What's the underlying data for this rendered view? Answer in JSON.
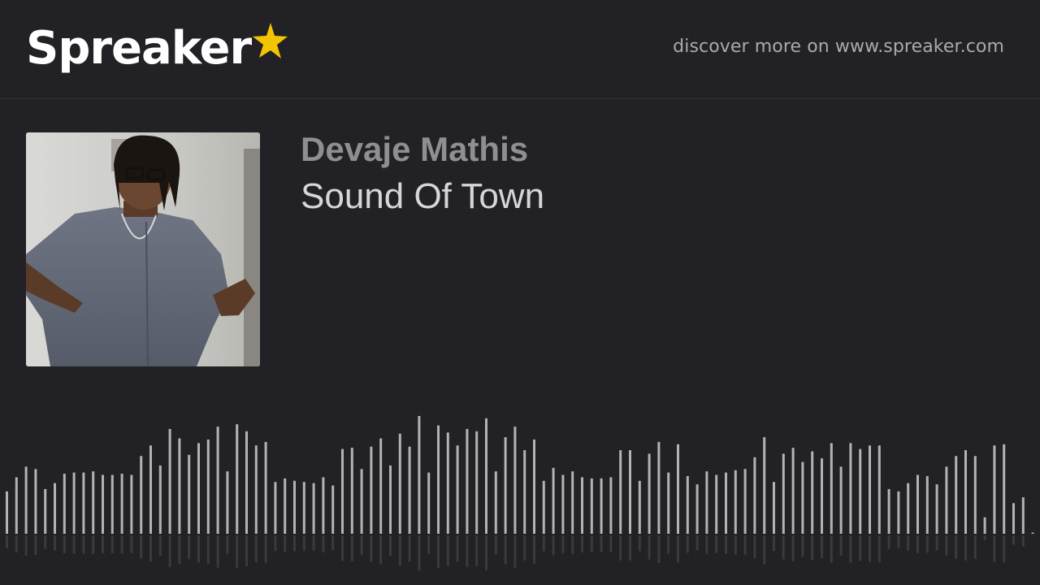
{
  "header": {
    "logo_text": "Spreaker",
    "discover_text": "discover more on www.spreaker.com"
  },
  "episode": {
    "author": "Devaje Mathis",
    "title": "Sound Of Town"
  },
  "waveform": {
    "levels": [
      0.36,
      0.48,
      0.57,
      0.55,
      0.38,
      0.43,
      0.51,
      0.52,
      0.52,
      0.53,
      0.5,
      0.5,
      0.51,
      0.5,
      0.66,
      0.75,
      0.58,
      0.89,
      0.81,
      0.67,
      0.77,
      0.8,
      0.91,
      0.53,
      0.93,
      0.87,
      0.75,
      0.78,
      0.44,
      0.47,
      0.45,
      0.44,
      0.43,
      0.48,
      0.41,
      0.72,
      0.73,
      0.55,
      0.74,
      0.81,
      0.58,
      0.85,
      0.74,
      1.0,
      0.52,
      0.92,
      0.86,
      0.75,
      0.89,
      0.87,
      0.98,
      0.53,
      0.82,
      0.91,
      0.71,
      0.8,
      0.45,
      0.56,
      0.5,
      0.53,
      0.48,
      0.47,
      0.47,
      0.48,
      0.71,
      0.71,
      0.45,
      0.68,
      0.78,
      0.52,
      0.76,
      0.49,
      0.42,
      0.53,
      0.5,
      0.52,
      0.54,
      0.55,
      0.65,
      0.82,
      0.44,
      0.68,
      0.73,
      0.61,
      0.7,
      0.64,
      0.77,
      0.57,
      0.77,
      0.72,
      0.75,
      0.75,
      0.38,
      0.36,
      0.43,
      0.5,
      0.49,
      0.42,
      0.57,
      0.66,
      0.71,
      0.66,
      0.14,
      0.75,
      0.76,
      0.26,
      0.31,
      0.01
    ],
    "bar_color": "#b3b3b6",
    "reflection_color": "#3a3a3e"
  },
  "colors": {
    "background": "#222226",
    "logo_star": "#f5c400",
    "title_text": "#d6d6da",
    "author_text": "#8e8e93"
  },
  "icons": {
    "logo_star": "star-icon"
  }
}
